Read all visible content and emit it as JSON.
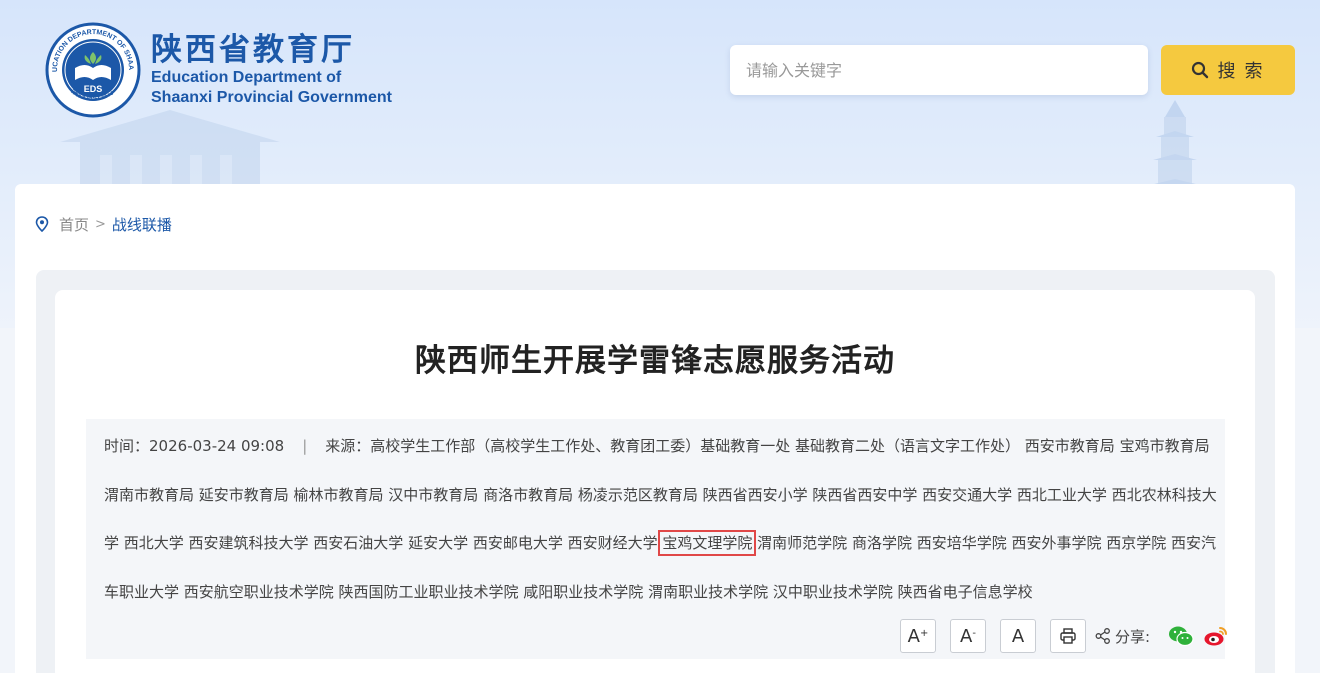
{
  "header": {
    "logo_cn": "陕西省教育厅",
    "logo_en_line1": "Education Department of",
    "logo_en_line2": "Shaanxi Provincial Government",
    "emblem_ring_text": "EDUCATION DEPARTMENT OF SHAANXI",
    "emblem_abbr": "EDS",
    "emblem_cn": "陕西省教育厅"
  },
  "search": {
    "placeholder": "请输入关键字",
    "button_label": "搜 索"
  },
  "breadcrumb": {
    "home": "首页",
    "separator": ">",
    "current": "战线联播"
  },
  "article": {
    "title": "陕西师生开展学雷锋志愿服务活动",
    "time_label": "时间：",
    "time_value": "2026-03-24 09:08",
    "separator": "|",
    "source_label": "来源：",
    "source_before": "高校学生工作部（高校学生工作处、教育团工委）基础教育一处 基础教育二处（语言文字工作处） 西安市教育局 宝鸡市教育局 渭南市教育局 延安市教育局 榆林市教育局 汉中市教育局 商洛市教育局 杨凌示范区教育局 陕西省西安小学 陕西省西安中学 西安交通大学 西北工业大学 西北农林科技大学 西北大学 西安建筑科技大学 西安石油大学 延安大学 西安邮电大学 西安财经大学 ",
    "source_highlight": "宝鸡文理学院",
    "source_after": " 渭南师范学院 商洛学院 西安培华学院 西安外事学院 西京学院 西安汽车职业大学 西安航空职业技术学院 陕西国防工业职业技术学院 咸阳职业技术学院 渭南职业技术学院 汉中职业技术学院 陕西省电子信息学校"
  },
  "tools": {
    "font_increase": "A",
    "font_decrease": "A",
    "font_reset": "A",
    "share_label": "分享:"
  },
  "colors": {
    "brand_blue": "#1c58a8",
    "search_button": "#f5c93f",
    "highlight_border": "#e04848"
  },
  "icons": [
    "search-icon",
    "location-pin-icon",
    "print-icon",
    "share-icon",
    "wechat-icon",
    "weibo-icon"
  ]
}
